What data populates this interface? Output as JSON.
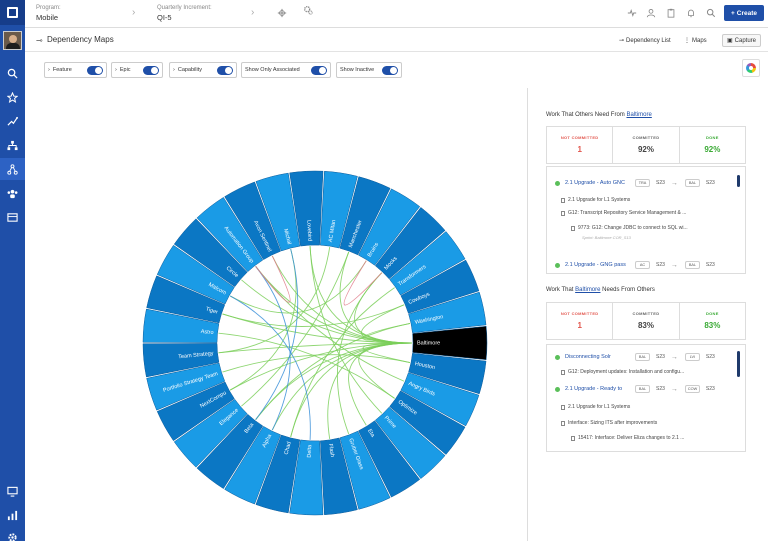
{
  "topbar": {
    "program_label": "Program:",
    "program_value": "Mobile",
    "pi_label": "Quarterly Increment:",
    "pi_value": "QI-5",
    "create_label": "Create"
  },
  "header": {
    "title": "Dependency Maps",
    "dependency_list_label": "Dependency List",
    "maps_label": "Maps",
    "capture_label": "Capture"
  },
  "filters": [
    {
      "label": "Feature",
      "on": true
    },
    {
      "label": "Epic",
      "on": true
    },
    {
      "label": "Capability",
      "on": true
    },
    {
      "label": "Show Only Associated",
      "on": true
    },
    {
      "label": "Show Inactive",
      "on": true
    }
  ],
  "chart_data": {
    "type": "chord",
    "selected": "Baltimore",
    "teams": [
      "Baltimore",
      "Houston",
      "Angry Birds",
      "Optimize",
      "Prime",
      "Eta",
      "Gruber Glass",
      "Flash",
      "Delta",
      "Chad",
      "Alpha",
      "Beta",
      "Elegance",
      "NextCompu",
      "Portfolio Strategy Team",
      "Team Strategy",
      "Astro",
      "Tiger",
      "Malcom",
      "Circle",
      "Automation Group",
      "Avon Sentinel",
      "Michal",
      "Lovebird",
      "AC Mitan",
      "Manchester",
      "Bruins",
      "Mocks",
      "Transformers",
      "Cowboys",
      "Washington"
    ]
  },
  "panel": {
    "section1_prefix": "Work That Others Need From",
    "section1_team": "Baltimore",
    "section1_stats": [
      {
        "label": "NOT COMMITTED",
        "value": "1"
      },
      {
        "label": "COMMITTED",
        "value": "92%"
      },
      {
        "label": "DONE",
        "value": "92%"
      }
    ],
    "section1_items": [
      {
        "title": "2.1 Upgrade - Auto GNC",
        "from": "TRA",
        "from_sprint": "S23",
        "to": "BAL",
        "to_sprint": "S23"
      },
      {
        "title": "2.1 Upgrade - GNG pass",
        "from": "AC",
        "from_sprint": "S23",
        "to": "BAL",
        "to_sprint": "S23"
      }
    ],
    "section1_children": [
      "2.1 Upgrade for L1 Systems",
      "G12: Transcript Repository Service Management & ...",
      "9773: G12: Change JDBC to connect to SQL wi...",
      "Sprint: Baltimore COR_S13"
    ],
    "section2_prefix": "Work That",
    "section2_team": "Baltimore",
    "section2_suffix": "Needs From Others",
    "section2_stats": [
      {
        "label": "NOT COMMITTED",
        "value": "1"
      },
      {
        "label": "COMMITTED",
        "value": "83%"
      },
      {
        "label": "DONE",
        "value": "83%"
      }
    ],
    "section2_items": [
      {
        "title": "Disconnecting Solr",
        "from": "BAL",
        "from_sprint": "S23",
        "to": "LVI",
        "to_sprint": "S23"
      },
      {
        "title": "2.1 Upgrade - Ready to",
        "from": "BAL",
        "from_sprint": "S23",
        "to": "COW",
        "to_sprint": "S23"
      }
    ],
    "section2_children": [
      "G12: Deployment updates: Installation and configu...",
      "2.1 Upgrade for L1 Systems",
      "Interface: Sizing ITS after improvements",
      "15417: Interface: Deliver Eliza changes to 2.1 ..."
    ]
  }
}
